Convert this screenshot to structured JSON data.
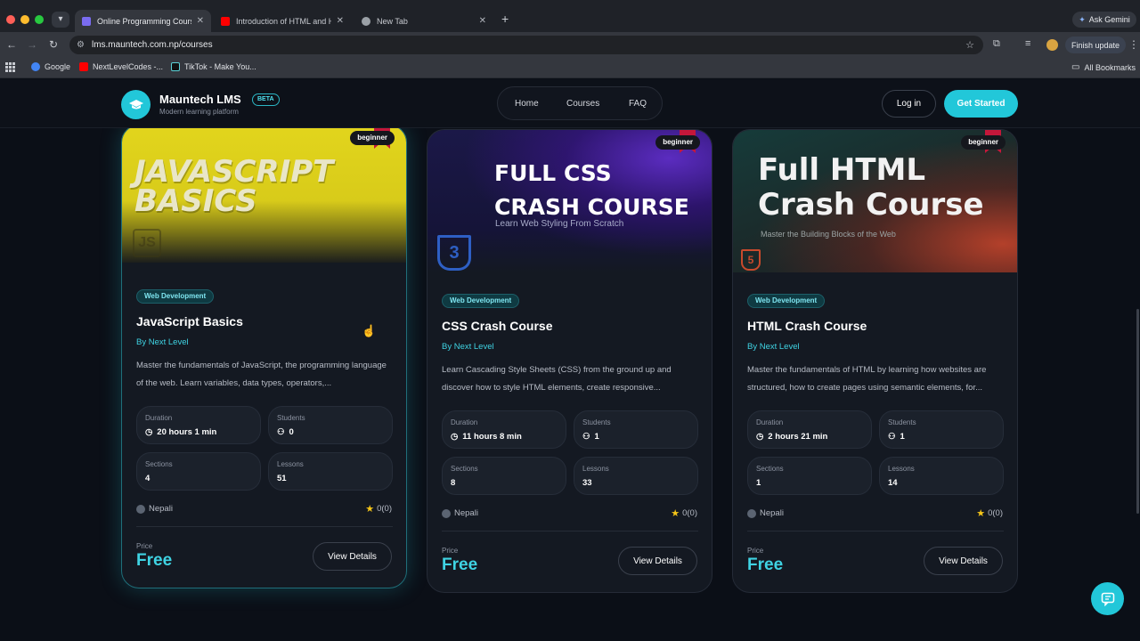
{
  "browser": {
    "tabs": [
      {
        "title": "Online Programming Courses",
        "active": true,
        "favicon_color": "#7a6cf0"
      },
      {
        "title": "Introduction of HTML and Ho",
        "active": false,
        "favicon_color": "#ff0000"
      },
      {
        "title": "New Tab",
        "active": false,
        "favicon_color": "#9aa0a6"
      }
    ],
    "ask_gemini": "Ask Gemini",
    "url": "lms.mauntech.com.np/courses",
    "finish_update": "Finish update",
    "bookmarks": [
      {
        "label": "Google",
        "icon_color": "#4285f4"
      },
      {
        "label": "NextLevelCodes -...",
        "icon_color": "#ff0000"
      },
      {
        "label": "TikTok - Make You...",
        "icon_color": "#111111"
      }
    ],
    "all_bookmarks": "All Bookmarks"
  },
  "site": {
    "brand": "Mauntech LMS",
    "beta": "BETA",
    "tagline": "Modern learning platform",
    "nav": [
      "Home",
      "Courses",
      "FAQ"
    ],
    "login": "Log in",
    "get_started": "Get Started"
  },
  "courses": [
    {
      "banner_line1": "JAVASCRIPT",
      "banner_line2": "BASICS",
      "banner_sub": "",
      "badge_level": "beginner",
      "category": "Web Development",
      "title": "JavaScript Basics",
      "author": "By Next Level",
      "description": "Master the fundamentals of JavaScript, the programming language of the web. Learn variables, data types, operators,...",
      "stats": {
        "duration_label": "Duration",
        "duration": "20 hours 1 min",
        "students_label": "Students",
        "students": "0",
        "sections_label": "Sections",
        "sections": "4",
        "lessons_label": "Lessons",
        "lessons": "51"
      },
      "language": "Nepali",
      "rating": "0(0)",
      "price_label": "Price",
      "price": "Free",
      "cta": "View Details"
    },
    {
      "banner_line1": "FULL CSS",
      "banner_line2": "CRASH COURSE",
      "banner_sub": "Learn Web Styling From Scratch",
      "badge_level": "beginner",
      "category": "Web Development",
      "title": "CSS Crash Course",
      "author": "By Next Level",
      "description": "Learn Cascading Style Sheets (CSS) from the ground up and discover how to style HTML elements, create responsive...",
      "stats": {
        "duration_label": "Duration",
        "duration": "11 hours 8 min",
        "students_label": "Students",
        "students": "1",
        "sections_label": "Sections",
        "sections": "8",
        "lessons_label": "Lessons",
        "lessons": "33"
      },
      "language": "Nepali",
      "rating": "0(0)",
      "price_label": "Price",
      "price": "Free",
      "cta": "View Details"
    },
    {
      "banner_line1": "Full HTML",
      "banner_line2": "Crash Course",
      "banner_sub": "Master the Building Blocks of the Web",
      "badge_level": "beginner",
      "category": "Web Development",
      "title": "HTML Crash Course",
      "author": "By Next Level",
      "description": "Master the fundamentals of HTML by learning how websites are structured, how to create pages using semantic elements, for...",
      "stats": {
        "duration_label": "Duration",
        "duration": "2 hours 21 min",
        "students_label": "Students",
        "students": "1",
        "sections_label": "Sections",
        "sections": "1",
        "lessons_label": "Lessons",
        "lessons": "14"
      },
      "language": "Nepali",
      "rating": "0(0)",
      "price_label": "Price",
      "price": "Free",
      "cta": "View Details"
    }
  ],
  "icons": {
    "logo": "graduation-cap-icon",
    "chat": "chat-icon",
    "clock": "clock-icon",
    "users": "users-icon",
    "globe": "globe-icon",
    "star": "star-icon"
  },
  "colors": {
    "accent": "#22c7d9",
    "price": "#3fd3e3",
    "badge_ribbon": "#c4173a",
    "star": "#f5c518"
  }
}
